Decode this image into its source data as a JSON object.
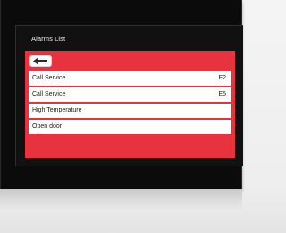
{
  "screen": {
    "title": "Alarms List",
    "back_icon": "back-arrow-icon"
  },
  "alarms": [
    {
      "label": "Call Service",
      "code": "E2"
    },
    {
      "label": "Call Service",
      "code": "E5"
    },
    {
      "label": "High Temperature",
      "code": ""
    },
    {
      "label": "Open door",
      "code": ""
    }
  ],
  "colors": {
    "panel_accent": "#e8323d",
    "row_background": "#ffffff",
    "screen_background": "#111111"
  }
}
